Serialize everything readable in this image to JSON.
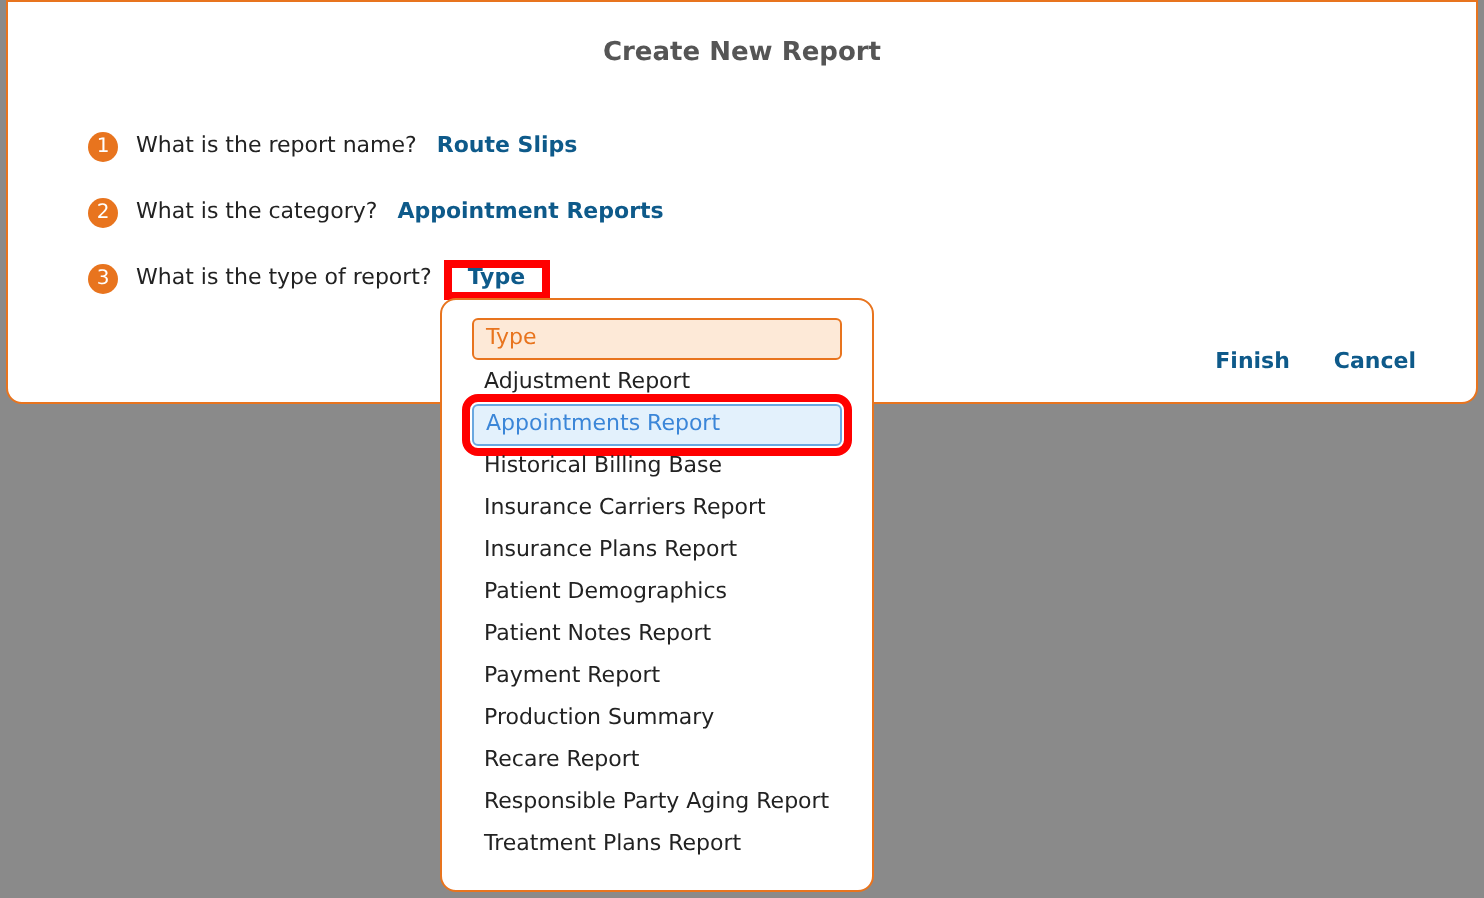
{
  "dialog": {
    "title": "Create New Report",
    "questions": [
      {
        "number": "1",
        "label": "What is the report name?",
        "answer": "Route Slips",
        "highlighted": false
      },
      {
        "number": "2",
        "label": "What is the category?",
        "answer": "Appointment Reports",
        "highlighted": false
      },
      {
        "number": "3",
        "label": "What is the type of report?",
        "answer": "Type",
        "highlighted": true
      }
    ],
    "buttons": [
      "Finish",
      "Cancel"
    ]
  },
  "dropdown": {
    "items": [
      {
        "label": "Type",
        "kind": "placeholder",
        "selected": false,
        "highlighted": false
      },
      {
        "label": "Adjustment Report",
        "kind": "option",
        "selected": false,
        "highlighted": false
      },
      {
        "label": "Appointments Report",
        "kind": "option",
        "selected": true,
        "highlighted": true
      },
      {
        "label": "Historical Billing Base",
        "kind": "option",
        "selected": false,
        "highlighted": false
      },
      {
        "label": "Insurance Carriers Report",
        "kind": "option",
        "selected": false,
        "highlighted": false
      },
      {
        "label": "Insurance Plans Report",
        "kind": "option",
        "selected": false,
        "highlighted": false
      },
      {
        "label": "Patient Demographics",
        "kind": "option",
        "selected": false,
        "highlighted": false
      },
      {
        "label": "Patient Notes Report",
        "kind": "option",
        "selected": false,
        "highlighted": false
      },
      {
        "label": "Payment Report",
        "kind": "option",
        "selected": false,
        "highlighted": false
      },
      {
        "label": "Production Summary",
        "kind": "option",
        "selected": false,
        "highlighted": false
      },
      {
        "label": "Recare Report",
        "kind": "option",
        "selected": false,
        "highlighted": false
      },
      {
        "label": "Responsible Party Aging Report",
        "kind": "option",
        "selected": false,
        "highlighted": false
      },
      {
        "label": "Treatment Plans Report",
        "kind": "option",
        "selected": false,
        "highlighted": false
      }
    ]
  }
}
